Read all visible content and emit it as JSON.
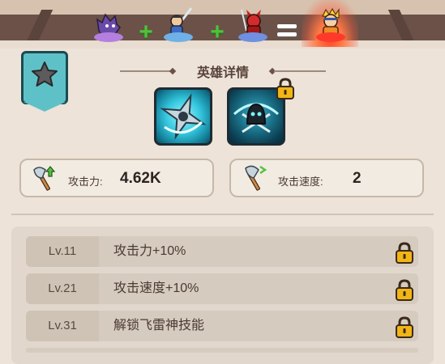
{
  "header": {
    "heroes": [
      "purple-wolf-hero",
      "blue-swordsman-hero",
      "red-devil-hero"
    ],
    "result_hero": "orange-ninja-hero",
    "operators": [
      "+",
      "+",
      "="
    ]
  },
  "panel": {
    "title": "英雄详情",
    "skills": [
      {
        "name": "shuriken-skill-icon",
        "locked": false
      },
      {
        "name": "shadow-skill-icon",
        "locked": true
      }
    ],
    "stats": [
      {
        "icon": "axe-up-icon",
        "label": "攻击力:",
        "value": "4.62K"
      },
      {
        "icon": "axe-speed-icon",
        "label": "攻击速度:",
        "value": "2"
      }
    ]
  },
  "levels": [
    {
      "level": "Lv.11",
      "bonus": "攻击力+10%",
      "locked": true
    },
    {
      "level": "Lv.21",
      "bonus": "攻击速度+10%",
      "locked": true
    },
    {
      "level": "Lv.31",
      "bonus": "解锁飞雷神技能",
      "locked": true
    }
  ],
  "colors": {
    "accent_teal": "#5fc1c8",
    "plus_green": "#4fc23b",
    "banner_brown": "#6b5147",
    "lock_gold": "#f2b516"
  }
}
